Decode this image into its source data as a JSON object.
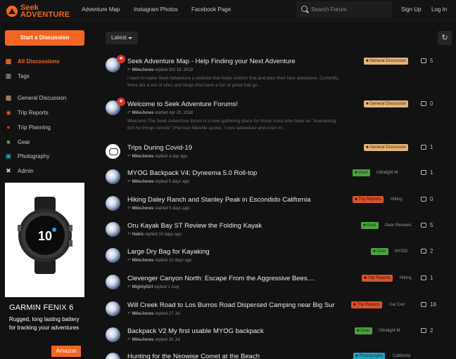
{
  "header": {
    "logo_line1": "Seek",
    "logo_line2": "ADVENTURE",
    "nav": [
      "Adventure Map",
      "Instagram Photos",
      "Facebook Page"
    ],
    "search_placeholder": "Search Forum",
    "sign_up": "Sign Up",
    "log_in": "Log In"
  },
  "sidebar": {
    "start_button": "Start a Discussion",
    "items": [
      {
        "label": "All Discussions",
        "icon": "chat-bubbles-icon",
        "active": true
      },
      {
        "label": "Tags",
        "icon": "grid-icon"
      },
      {
        "label": "General Discussion",
        "icon": "chat-bubbles-icon"
      },
      {
        "label": "Trip Reports",
        "icon": "binoculars-icon"
      },
      {
        "label": "Trip Planning",
        "icon": "map-pin-icon"
      },
      {
        "label": "Gear",
        "icon": "backpack-icon"
      },
      {
        "label": "Photography",
        "icon": "camera-icon"
      },
      {
        "label": "Admin",
        "icon": "tools-icon"
      }
    ]
  },
  "ad": {
    "watch_time": "10",
    "title": "GARMIN FENIX 6",
    "text": "Rugged, long lasting battery for tracking your adventures",
    "button": "Amazon"
  },
  "toolbar": {
    "sort_label": "Latest"
  },
  "discussions": [
    {
      "title": "Seek Adventure Map - Help Finding your Next Adventure",
      "pinned": true,
      "meta_user": "MikeJones",
      "meta_action": "replied Oct 18, 2019",
      "excerpt": "I want to make Seek Adventure a website that helps visitors find and plan their next adventure. Currently, there are a ton of sites and blogs that have a ton of great trail gu...",
      "tag": "General Discussion",
      "tag_type": "gd",
      "subtag": "",
      "count": "5"
    },
    {
      "title": "Welcome to Seek Adventure Forums!",
      "pinned": true,
      "meta_user": "MikeJones",
      "meta_action": "started Apr 20, 2018",
      "excerpt": "Welcome The Seek Adventure forum is a new gathering place for those soles who have an \"everlasting itch for things remote\" (Herman Melville quote). I love adventure and even m...",
      "tag": "General Discussion",
      "tag_type": "gd",
      "subtag": "",
      "count": "0"
    },
    {
      "title": "Trips During Covid-19",
      "pinned": false,
      "avatar": "alt",
      "meta_user": "MikeJones",
      "meta_action": "replied a day ago",
      "tag": "General Discussion",
      "tag_type": "gd",
      "subtag": "",
      "count": "1"
    },
    {
      "title": "MYOG Backpack V4: Dyneema 5.0 Roll-top",
      "pinned": false,
      "meta_user": "MikeJones",
      "meta_action": "replied 5 days ago",
      "tag": "Gear",
      "tag_type": "gear",
      "subtag": "Ultralight",
      "subtag2": "M",
      "count": "1"
    },
    {
      "title": "Hiking Daley Ranch and Stanley Peak in Escondido California",
      "pinned": false,
      "meta_user": "MikeJones",
      "meta_action": "started 5 days ago",
      "tag": "Trip Reports",
      "tag_type": "trip",
      "subtag": "Hiking",
      "count": "0"
    },
    {
      "title": "Oru Kayak Bay ST Review the Folding Kayak",
      "pinned": false,
      "meta_user": "Habix",
      "meta_action": "replied 10 days ago",
      "tag": "Gear",
      "tag_type": "gear",
      "subtag": "Gear Reviews",
      "count": "5"
    },
    {
      "title": "Large Dry Bag for Kayaking",
      "pinned": false,
      "meta_user": "MikeJones",
      "meta_action": "replied 10 days ago",
      "tag": "Gear",
      "tag_type": "gear",
      "subtag": "MYOG",
      "count": "2"
    },
    {
      "title": "Clevenger Canyon North: Escape From the Aggressive Bees....",
      "pinned": false,
      "meta_user": "MightyGirl",
      "meta_action": "replied 1 Aug",
      "tag": "Trip Reports",
      "tag_type": "trip",
      "subtag": "Hiking",
      "count": "1"
    },
    {
      "title": "Will Creek Road to Los Burros Road Dispersed Camping near Big Sur",
      "pinned": false,
      "meta_user": "MikeJones",
      "meta_action": "replied 27 Jul",
      "tag": "Trip Reports",
      "tag_type": "trip",
      "subtag": "Car Can",
      "count": "18"
    },
    {
      "title": "Backpack V2 My first usable MYOG backpack",
      "pinned": false,
      "meta_user": "MikeJones",
      "meta_action": "replied 26 Jul",
      "tag": "Gear",
      "tag_type": "gear",
      "subtag": "Ultralight",
      "subtag2": "M",
      "count": "2"
    },
    {
      "title": "Hunting for the Neowise Comet at the Beach",
      "pinned": false,
      "meta_user": "",
      "meta_action": "",
      "tag": "Photography",
      "tag_type": "photo",
      "subtag": "California",
      "count": ""
    }
  ],
  "colors": {
    "accent": "#f26522",
    "background": "#121212"
  }
}
